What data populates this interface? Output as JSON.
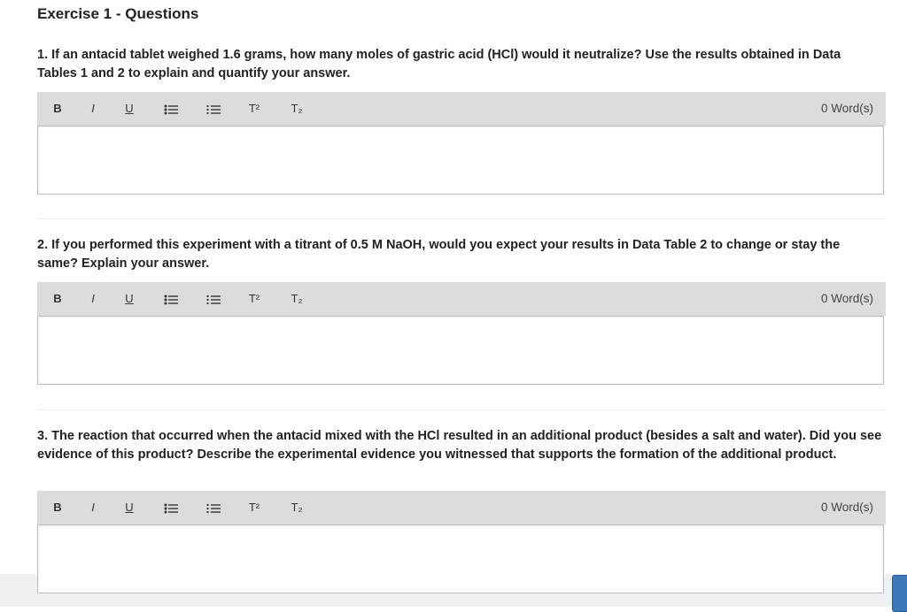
{
  "page": {
    "title": "Exercise 1 - Questions"
  },
  "toolbar": {
    "bold": "B",
    "italic": "I",
    "underline": "U",
    "superscript": "T²",
    "subscript": "T₂",
    "word_count": "0 Word(s)"
  },
  "questions": [
    {
      "text": "1. If an antacid tablet weighed 1.6 grams, how many moles of gastric acid (HCl) would it neutralize? Use the results obtained in Data Tables 1 and 2 to explain and quantify your answer."
    },
    {
      "text": "2. If you performed this experiment with a titrant of 0.5 M NaOH, would you expect your results in Data Table 2 to change or stay the same? Explain your answer."
    },
    {
      "text": "3. The reaction that occurred when the antacid mixed with the HCl resulted in an additional product (besides a salt and water). Did you see evidence of this product? Describe the experimental evidence you witnessed that supports the formation of the additional product."
    }
  ]
}
